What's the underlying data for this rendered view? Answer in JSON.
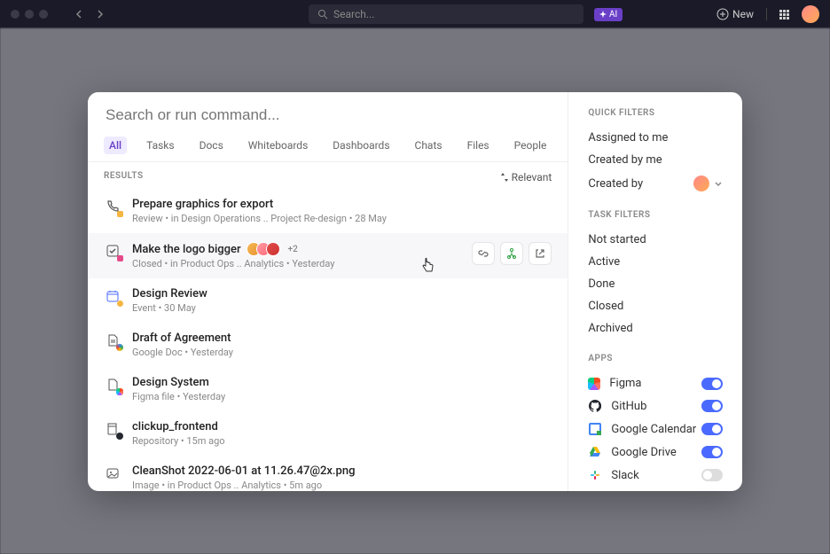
{
  "topbar": {
    "search_placeholder": "Search...",
    "ai_label": "AI",
    "new_label": "New"
  },
  "modal": {
    "search_placeholder": "Search or run command...",
    "tabs": [
      "All",
      "Tasks",
      "Docs",
      "Whiteboards",
      "Dashboards",
      "Chats",
      "Files",
      "People"
    ],
    "active_tab_index": 0,
    "results_label": "RESULTS",
    "sort_label": "Relevant",
    "results": [
      {
        "title": "Prepare graphics for export",
        "meta": "Review  •  in Design Operations ..   Project Re-design  •  28 May",
        "icon": "phone-task",
        "dot_color": "#f5b642"
      },
      {
        "title": "Make the logo bigger",
        "meta": "Closed  •  in Product Ops ..   Analytics  •  Yesterday",
        "icon": "check-task",
        "dot_color": "#e64a8a",
        "assignees_extra": "+2",
        "hovered": true
      },
      {
        "title": "Design Review",
        "meta": "Event  •  30 May",
        "icon": "calendar-event"
      },
      {
        "title": "Draft of Agreement",
        "meta": "Google Doc  •  Yesterday",
        "icon": "google-doc"
      },
      {
        "title": "Design System",
        "meta": "Figma file  •  Yesterday",
        "icon": "figma-file"
      },
      {
        "title": "clickup_frontend",
        "meta": "Repository  •  15m ago",
        "icon": "repository"
      },
      {
        "title": "CleanShot 2022-06-01 at 11.26.47@2x.png",
        "meta": "Image  •  in Product Ops ..   Analytics  •  5m ago",
        "icon": "image-file"
      }
    ]
  },
  "right": {
    "quick_filters_label": "QUICK FILTERS",
    "quick_filters": [
      "Assigned to me",
      "Created by me",
      "Created by"
    ],
    "task_filters_label": "TASK FILTERS",
    "task_filters": [
      "Not started",
      "Active",
      "Done",
      "Closed",
      "Archived"
    ],
    "apps_label": "APPS",
    "apps": [
      {
        "name": "Figma",
        "icon": "figma",
        "enabled": true
      },
      {
        "name": "GitHub",
        "icon": "github",
        "enabled": true
      },
      {
        "name": "Google Calendar",
        "icon": "gcal",
        "enabled": true
      },
      {
        "name": "Google Drive",
        "icon": "gdrive",
        "enabled": true
      },
      {
        "name": "Slack",
        "icon": "slack",
        "enabled": false
      }
    ]
  }
}
